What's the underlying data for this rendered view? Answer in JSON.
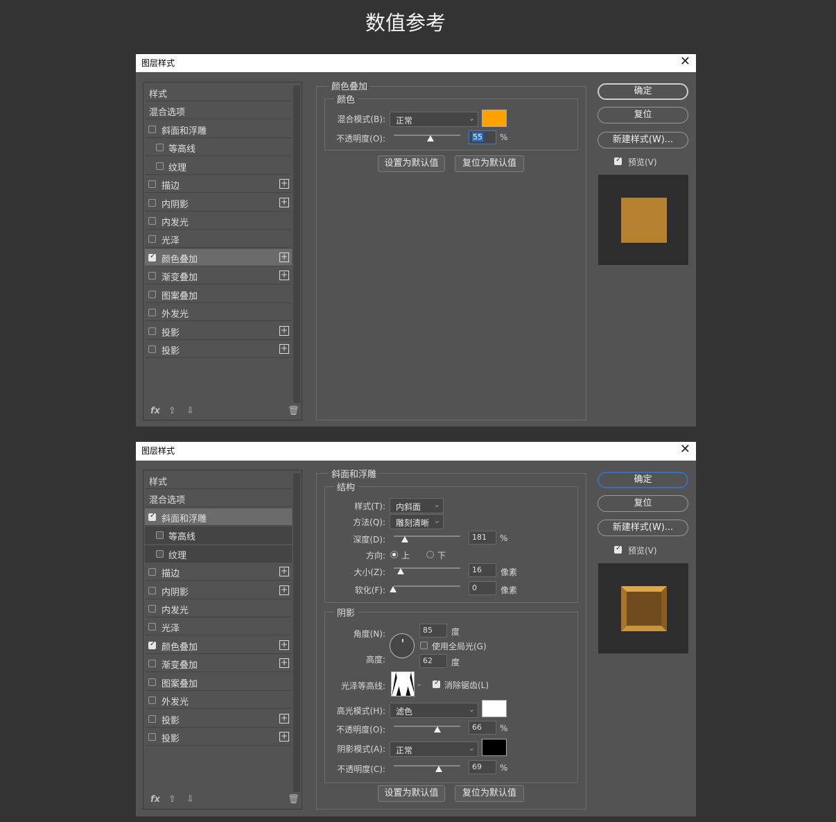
{
  "page_title": "数值参考",
  "dialog_title": "图层样式",
  "style_list": {
    "items": [
      "样式",
      "混合选项",
      "斜面和浮雕",
      "等高线",
      "纹理",
      "描边",
      "内阴影",
      "内发光",
      "光泽",
      "颜色叠加",
      "渐变叠加",
      "图案叠加",
      "外发光",
      "投影",
      "投影"
    ]
  },
  "buttons": {
    "ok": "确定",
    "reset": "复位",
    "new_style": "新建样式(W)...",
    "preview": "预览(V)",
    "make_default": "设置为默认值",
    "reset_default": "复位为默认值"
  },
  "footer": {
    "fx": "fx",
    "up": "⇧",
    "down": "⇩",
    "trash": "🗑"
  },
  "dialog1": {
    "section_title": "颜色叠加",
    "group_title": "颜色",
    "blend_mode_label": "混合模式(B):",
    "blend_mode": "正常",
    "overlay_color": "#ffa200",
    "opacity_label": "不透明度(O):",
    "opacity": "55",
    "opacity_unit": "%",
    "preview_color": "#b5812f"
  },
  "dialog2": {
    "section_title": "斜面和浮雕",
    "structure_title": "结构",
    "style_label": "样式(T):",
    "style_value": "内斜面",
    "technique_label": "方法(Q):",
    "technique_value": "雕刻清晰",
    "depth_label": "深度(D):",
    "depth": "181",
    "depth_unit": "%",
    "direction_label": "方向:",
    "dir_up": "上",
    "dir_down": "下",
    "size_label": "大小(Z):",
    "size": "16",
    "size_unit": "像素",
    "soften_label": "软化(F):",
    "soften": "0",
    "soften_unit": "像素",
    "shading_title": "阴影",
    "angle_label": "角度(N):",
    "angle": "85",
    "angle_unit": "度",
    "global_light": "使用全局光(G)",
    "altitude_label": "高度:",
    "altitude": "62",
    "altitude_unit": "度",
    "gloss_label": "光泽等高线:",
    "anti_alias": "消除锯齿(L)",
    "highlight_label": "高光模式(H):",
    "highlight_mode": "滤色",
    "highlight_color": "#ffffff",
    "hl_opacity_label": "不透明度(O):",
    "hl_opacity": "66",
    "hl_opacity_unit": "%",
    "shadow_label": "阴影模式(A):",
    "shadow_mode": "正常",
    "shadow_color": "#000000",
    "sh_opacity_label": "不透明度(C):",
    "sh_opacity": "69",
    "sh_opacity_unit": "%"
  }
}
